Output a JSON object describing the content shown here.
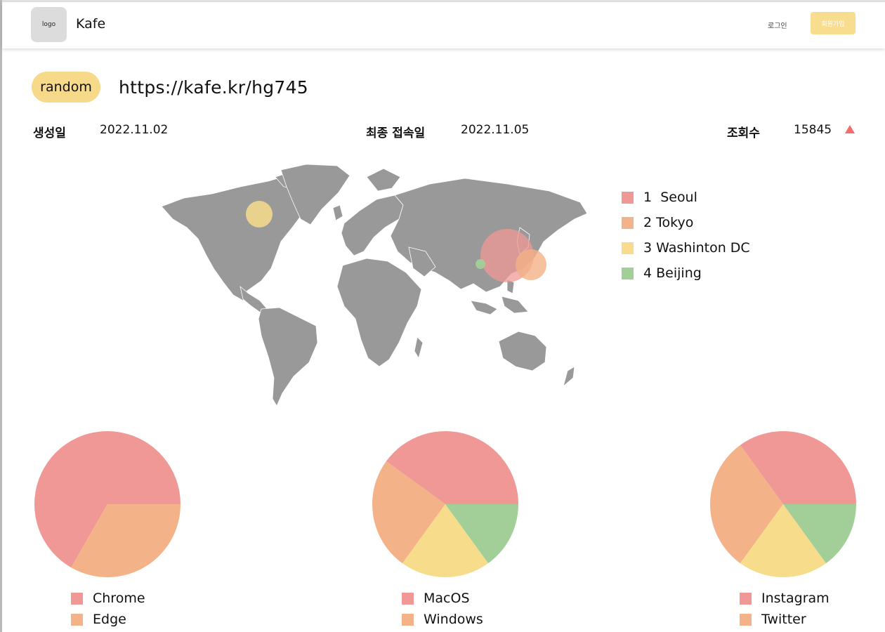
{
  "colors": {
    "red": "#f09896",
    "orange": "#f3b287",
    "yellow": "#f7dc8b",
    "green": "#a2cf98",
    "accent": "#f7d98a",
    "arrow": "#f26d6d"
  },
  "header": {
    "logo": "logo",
    "title": "Kafe",
    "login": "로그인",
    "signup": "회원가입"
  },
  "site": {
    "tag": "random",
    "url": "https://kafe.kr/hg745"
  },
  "stats": {
    "created_label": "생성일",
    "created_value": "2022.11.02",
    "last_label": "최종 접속일",
    "last_value": "2022.11.05",
    "views_label": "조회수",
    "views_value": "15845",
    "trend_icon": "triangle-up-icon"
  },
  "map_legend": [
    {
      "rank": "1",
      "city": "Seoul"
    },
    {
      "rank": "2",
      "city": "Tokyo"
    },
    {
      "rank": "3",
      "city": "Washinton DC"
    },
    {
      "rank": "4",
      "city": "Beijing"
    }
  ],
  "chart_data": [
    {
      "type": "pie",
      "labels": [
        "Chrome",
        "Edge"
      ],
      "values": [
        66.7,
        33.3
      ]
    },
    {
      "type": "pie",
      "labels": [
        "MacOS",
        "Windows",
        "",
        ""
      ],
      "values": [
        40,
        25,
        20,
        15
      ]
    },
    {
      "type": "pie",
      "labels": [
        "Instagram",
        "Twitter",
        "",
        ""
      ],
      "values": [
        35,
        30,
        20,
        15
      ]
    }
  ]
}
